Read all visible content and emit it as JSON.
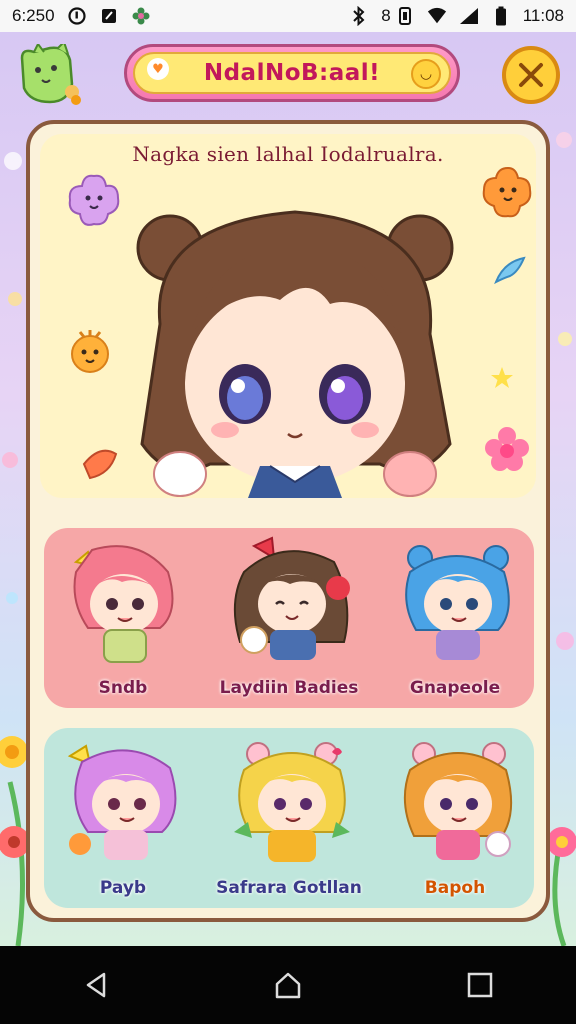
{
  "status_bar": {
    "time_left": "6:250",
    "time_right": "11:08",
    "battery": "8"
  },
  "header": {
    "title": "NdalNoB:aal!"
  },
  "hero": {
    "caption": "Nagka sien lalhal Iodalrualra."
  },
  "characters": [
    {
      "name": "Sndb",
      "hair": "#f47a8e",
      "outfit": "#cfe08a",
      "accessory": "yellow-bow"
    },
    {
      "name": "Laydiin Badies",
      "hair": "#6a4a36",
      "outfit": "#4a6fb0",
      "accessory": "red-bow"
    },
    {
      "name": "Gnapeole",
      "hair": "#4aa3e6",
      "outfit": "#a78ad6",
      "accessory": "blue-ears"
    },
    {
      "name": "Payb",
      "hair": "#d88ae8",
      "outfit": "#f5c1d8",
      "accessory": "yellow-bow"
    },
    {
      "name": "Safrara Gotllan",
      "hair": "#f5d34a",
      "outfit": "#f5b52a",
      "accessory": "pink-ears"
    },
    {
      "name": "Bapoh",
      "hair": "#f0a03a",
      "outfit": "#f06a9a",
      "accessory": "pink-ears"
    }
  ],
  "colors": {
    "panel_border": "#8a5a3e",
    "header_pink": "#f578b0",
    "header_yellow": "#ffe975",
    "card_pink": "#f6a7a7",
    "card_mint": "#bfe6dc"
  },
  "icons": {
    "status_left": [
      "app-icon-p",
      "note-icon",
      "flower-icon"
    ],
    "status_right": [
      "bluetooth-icon",
      "vibrate-icon",
      "wifi-icon",
      "signal-icon",
      "battery-icon"
    ],
    "nav": [
      "back-icon",
      "home-icon",
      "recents-icon"
    ]
  }
}
